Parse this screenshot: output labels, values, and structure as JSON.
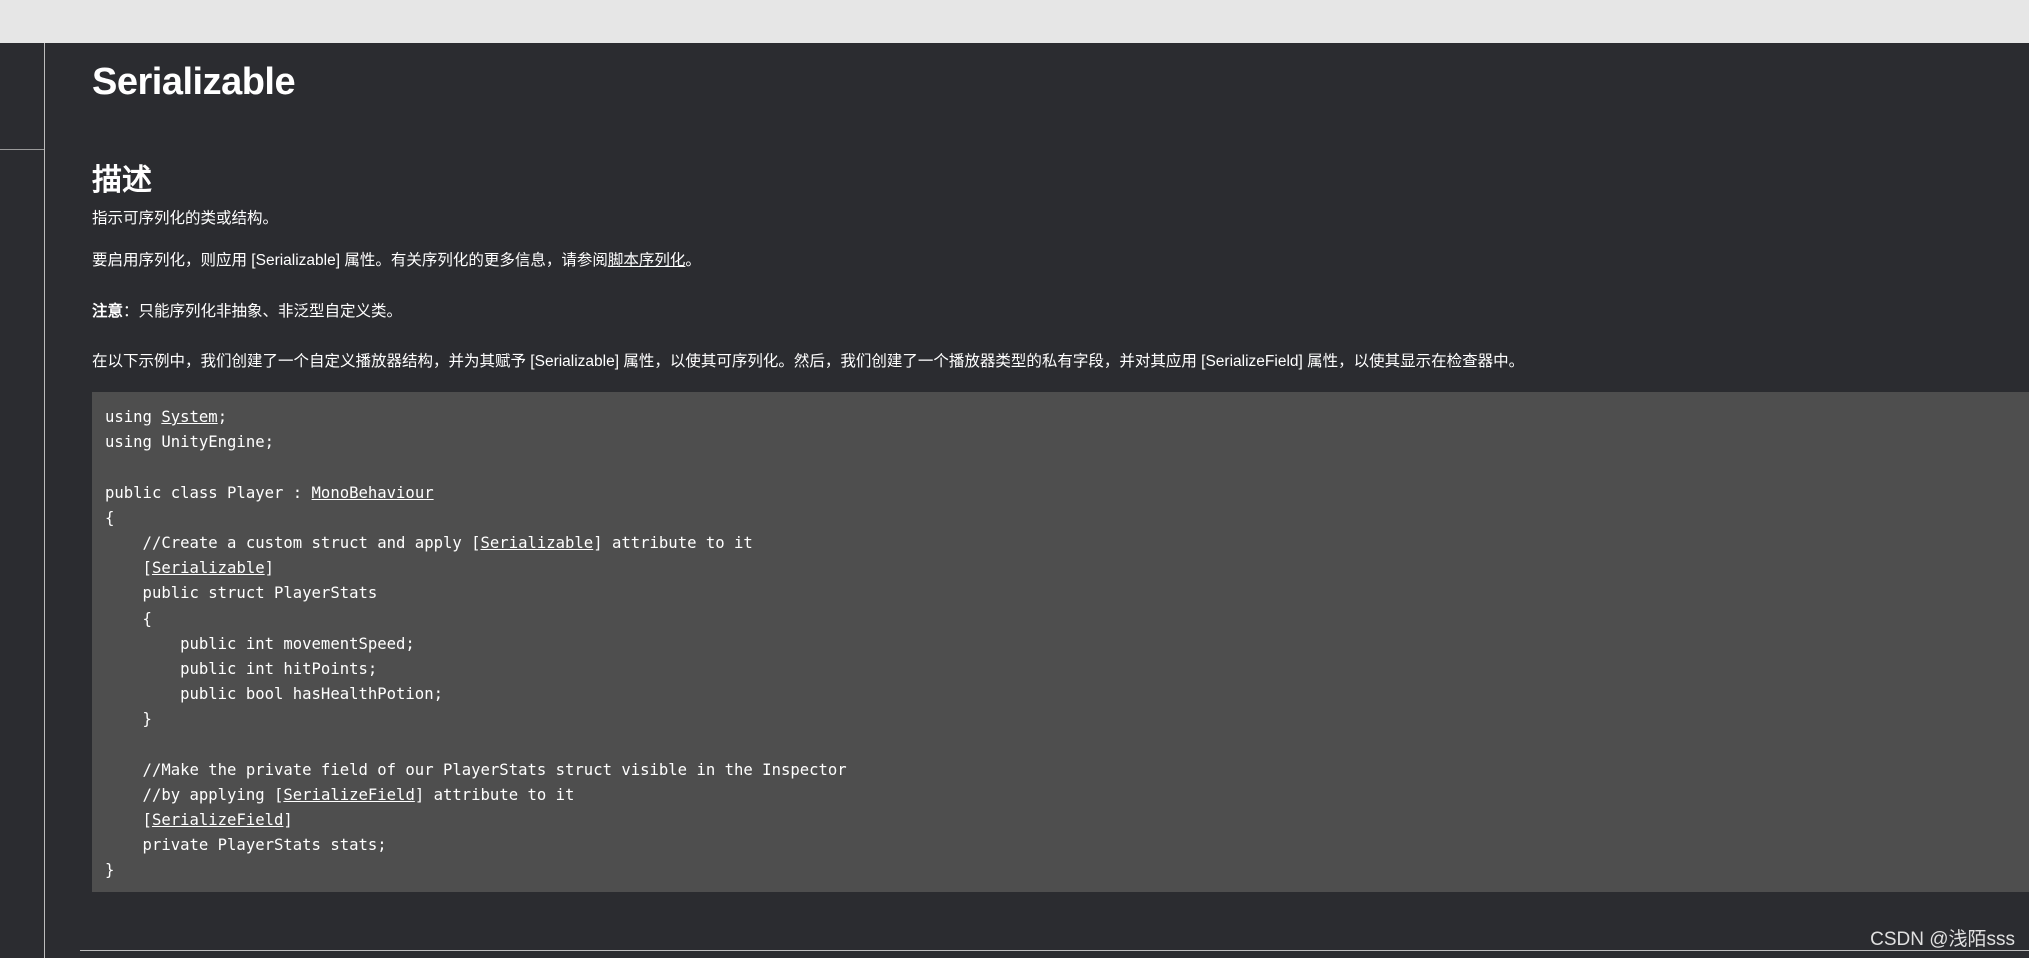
{
  "page": {
    "title": "Serializable",
    "section_heading": "描述",
    "p1": "指示可序列化的类或结构。",
    "p2_before": "要启用序列化，则应用 [Serializable] 属性。有关序列化的更多信息，请参阅",
    "p2_link": "脚本序列化",
    "p2_after": "。",
    "note_label": "注意",
    "note_text": "：只能序列化非抽象、非泛型自定义类。",
    "p4": "在以下示例中，我们创建了一个自定义播放器结构，并为其赋予 [Serializable] 属性，以使其可序列化。然后，我们创建了一个播放器类型的私有字段，并对其应用 [SerializeField] 属性，以使其显示在检查器中。"
  },
  "code": {
    "l1_a": "using ",
    "l1_link": "System",
    "l1_b": ";",
    "l2": "using UnityEngine;",
    "l4_a": "public class Player : ",
    "l4_link": "MonoBehaviour",
    "l5": "{",
    "l6_a": "    //Create a custom struct and apply [",
    "l6_link": "Serializable",
    "l6_b": "] attribute to it",
    "l7_a": "    [",
    "l7_link": "Serializable",
    "l7_b": "]",
    "l8": "    public struct PlayerStats",
    "l9": "    {",
    "l10": "        public int movementSpeed;",
    "l11": "        public int hitPoints;",
    "l12": "        public bool hasHealthPotion;",
    "l13": "    }",
    "l15": "    //Make the private field of our PlayerStats struct visible in the Inspector",
    "l16_a": "    //by applying [",
    "l16_link": "SerializeField",
    "l16_b": "] attribute to it",
    "l17_a": "    [",
    "l17_link": "SerializeField",
    "l17_b": "]",
    "l18": "    private PlayerStats stats;",
    "l19": "}"
  },
  "watermark": "CSDN @浅陌sss",
  "colors": {
    "background": "#2b2c30",
    "code_background": "#4e4e4e",
    "top_bar": "#e6e6e6",
    "text": "#ffffff"
  }
}
